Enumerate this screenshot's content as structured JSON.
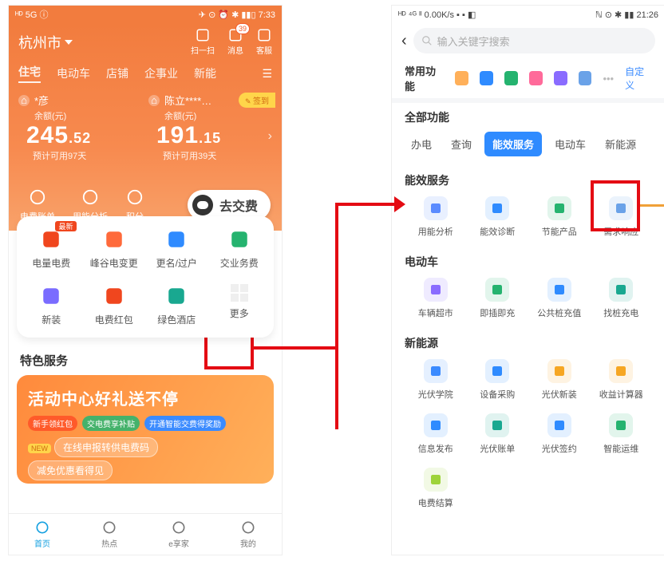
{
  "left": {
    "status": {
      "l": "ᴴᴰ 5G ⓘ",
      "r": "✈ ⊙ ⏰ ✱ ▮▮▯ 7:33"
    },
    "location": "杭州市",
    "topicons": [
      {
        "name": "scan-icon",
        "label": "扫一扫"
      },
      {
        "name": "message-icon",
        "label": "消息",
        "badge": "39"
      },
      {
        "name": "headset-icon",
        "label": "客服"
      }
    ],
    "tabs": [
      "住宅",
      "电动车",
      "店铺",
      "企事业",
      "新能"
    ],
    "balance": [
      {
        "name": "*彦",
        "label": "余额(元)",
        "int": "245",
        "dec": ".52",
        "est": "预计可用97天"
      },
      {
        "name": "陈立****…",
        "label": "余额(元)",
        "int": "191",
        "dec": ".15",
        "est": "预计可用39天",
        "sign": "签到"
      }
    ],
    "actions": [
      {
        "name": "bill-icon",
        "label": "电费账单"
      },
      {
        "name": "pie-icon",
        "label": "用能分析"
      },
      {
        "name": "points-icon",
        "label": "积分"
      }
    ],
    "pay": "去交费",
    "grid": [
      {
        "icon": "chart",
        "label": "电量电费",
        "color": "#f0461e",
        "badge": "最新"
      },
      {
        "icon": "wave",
        "label": "峰谷电变更",
        "color": "#ff6a3b"
      },
      {
        "icon": "rename",
        "label": "更名/过户",
        "color": "#2f8bff"
      },
      {
        "icon": "fee",
        "label": "交业务费",
        "color": "#25b36f"
      },
      {
        "icon": "install",
        "label": "新装",
        "color": "#7a6cff"
      },
      {
        "icon": "redpacket",
        "label": "电费红包",
        "color": "#f0461e"
      },
      {
        "icon": "hotel",
        "label": "绿色酒店",
        "color": "#19a890"
      },
      {
        "icon": "more",
        "label": "更多",
        "color": "#ccc"
      }
    ],
    "special": "特色服务",
    "promo": {
      "title": "活动中心好礼送不停",
      "pills": [
        "新手领红包",
        "交电费享补贴",
        "开通智能交费得奖励"
      ],
      "new": "NEW",
      "l1": "在线申报转供电费码",
      "l2": "减免优惠看得见"
    },
    "nav": [
      {
        "name": "home-icon",
        "label": "首页"
      },
      {
        "name": "news-icon",
        "label": "热点"
      },
      {
        "name": "efamily-icon",
        "label": "e享家"
      },
      {
        "name": "profile-icon",
        "label": "我的"
      }
    ]
  },
  "right": {
    "status": {
      "l": "ᴴᴰ ⁴ᴳ ᴵᴵ 0.00K/s ▪ ▪ ◧",
      "r": "ℕ ⊙ ✱ ▮▮ 21:26"
    },
    "search_ph": "输入关键字搜索",
    "freq_label": "常用功能",
    "customize": "自定义",
    "all": "全部功能",
    "tabs": [
      "办电",
      "查询",
      "能效服务",
      "电动车",
      "新能源"
    ],
    "sections": [
      {
        "title": "能效服务",
        "items": [
          {
            "label": "用能分析",
            "c": "#5a8bff"
          },
          {
            "label": "能效诊断",
            "c": "#2f8bff"
          },
          {
            "label": "节能产品",
            "c": "#25b36f"
          },
          {
            "label": "需求响应",
            "c": "#6aa2e8"
          }
        ]
      },
      {
        "title": "电动车",
        "items": [
          {
            "label": "车辆超市",
            "c": "#8a6cff"
          },
          {
            "label": "即插即充",
            "c": "#25b36f"
          },
          {
            "label": "公共桩充值",
            "c": "#2f8bff"
          },
          {
            "label": "找桩充电",
            "c": "#19a890"
          }
        ]
      },
      {
        "title": "新能源",
        "items": [
          {
            "label": "光伏学院",
            "c": "#3b8bff"
          },
          {
            "label": "设备采购",
            "c": "#2f8bff"
          },
          {
            "label": "光伏新装",
            "c": "#f6a623"
          },
          {
            "label": "收益计算器",
            "c": "#f6a623"
          },
          {
            "label": "信息发布",
            "c": "#2f8bff"
          },
          {
            "label": "光伏账单",
            "c": "#19a890"
          },
          {
            "label": "光伏签约",
            "c": "#2f8bff"
          },
          {
            "label": "智能运维",
            "c": "#25b36f"
          },
          {
            "label": "电费结算",
            "c": "#9ed33a"
          }
        ]
      }
    ]
  }
}
